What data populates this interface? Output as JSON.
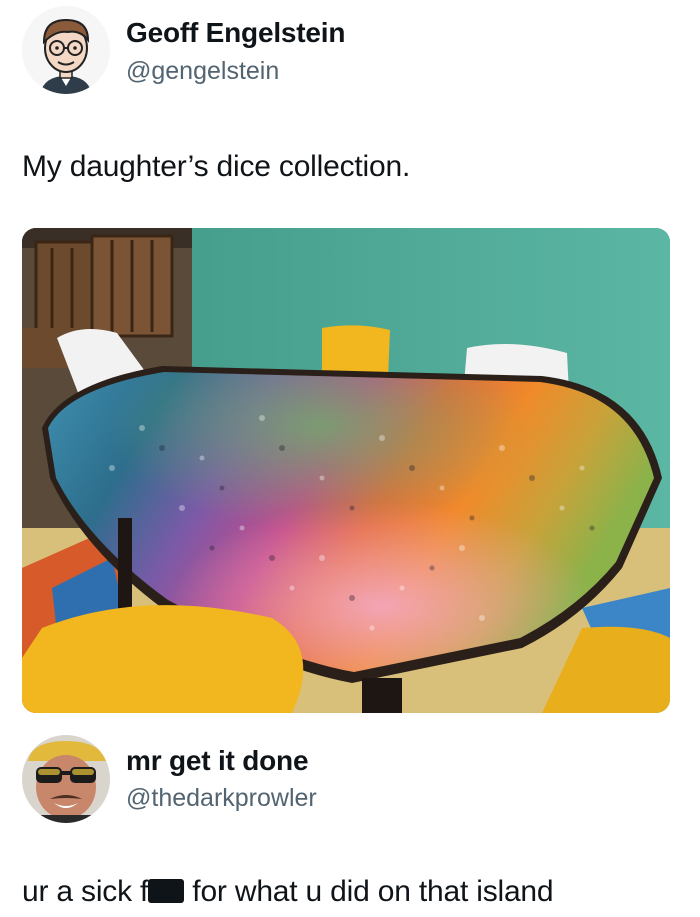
{
  "tweet": {
    "author_name": "Geoff Engelstein",
    "author_handle": "@gengelstein",
    "text": "My daughter’s dice collection.",
    "avatar_icon": "cartoon-face-avatar-icon",
    "photo_icon": "dice-collection-photo"
  },
  "reply": {
    "author_name": "mr get it done",
    "author_handle": "@thedarkprowler",
    "text_before": "ur a sick f",
    "text_after": " for what u did on that island",
    "avatar_icon": "sunglasses-man-avatar-icon"
  },
  "colors": {
    "wall": "#4ea896",
    "chair_yellow": "#f2b61e",
    "table_edge": "#2b1f1a",
    "text_primary": "#0f1419",
    "text_secondary": "#536471"
  }
}
